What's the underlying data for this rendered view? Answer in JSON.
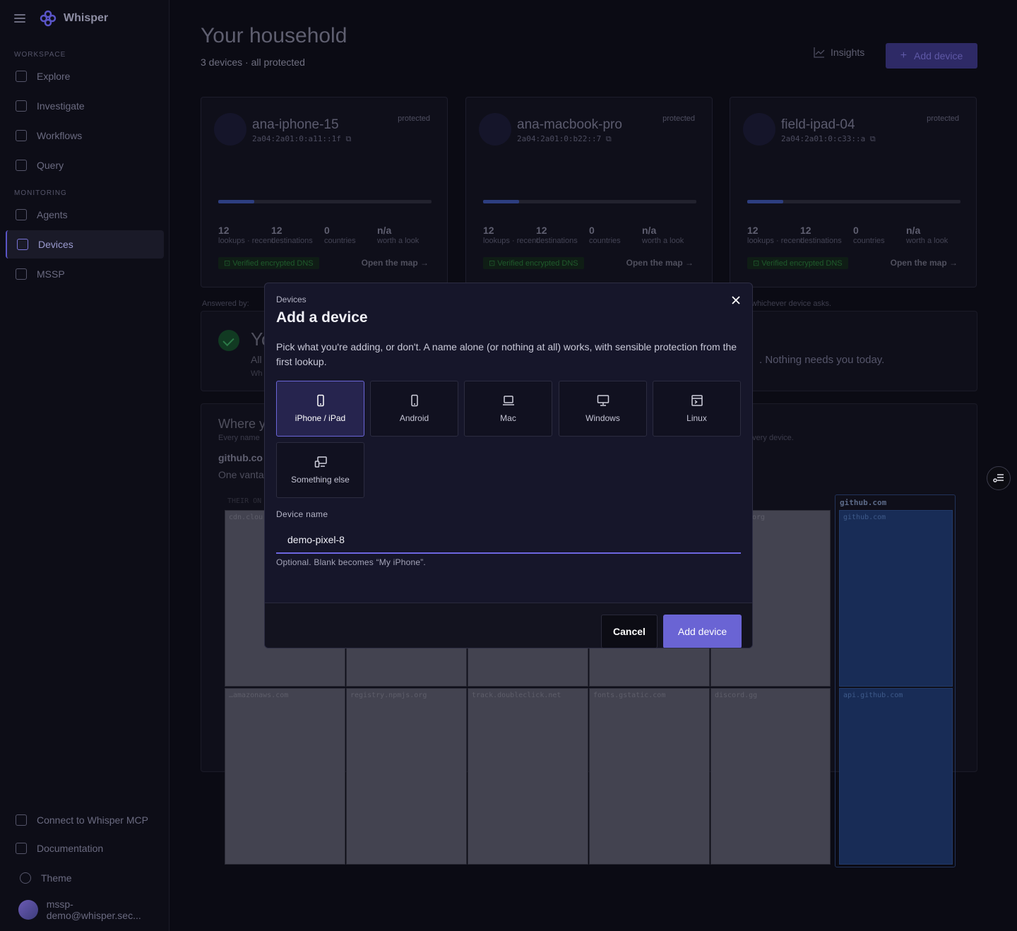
{
  "app": {
    "name": "Whisper"
  },
  "sidebar": {
    "sections": {
      "workspace": "WORKSPACE",
      "monitoring": "MONITORING"
    },
    "workspace_items": [
      {
        "label": "Explore",
        "icon": "explore-icon"
      },
      {
        "label": "Investigate",
        "icon": "investigate-icon"
      },
      {
        "label": "Workflows",
        "icon": "workflows-icon"
      },
      {
        "label": "Query",
        "icon": "query-icon"
      }
    ],
    "monitoring_items": [
      {
        "label": "Agents",
        "icon": "agents-icon"
      },
      {
        "label": "Devices",
        "icon": "devices-icon",
        "active": true
      },
      {
        "label": "MSSP",
        "icon": "mssp-icon"
      }
    ],
    "footer": {
      "mcp": "Connect to Whisper MCP",
      "docs": "Documentation",
      "theme": "Theme",
      "user": "mssp-demo@whisper.sec..."
    }
  },
  "page": {
    "title": "Your household",
    "subtitle": "3 devices · all protected",
    "insights": "Insights",
    "add_device": "Add device"
  },
  "devices": [
    {
      "name": "ana-iphone-15",
      "ip": "2a04:2a01:0:a11::1f",
      "status": "protected",
      "lookups": "12",
      "lookups_label": "lookups · recent",
      "destinations": "12",
      "destinations_label": "destinations",
      "countries": "0",
      "countries_label": "countries",
      "worth": "n/a",
      "worth_label": "worth a look",
      "dns": "Verified encrypted DNS",
      "open_map": "Open the map",
      "usage_fraction": 0.17
    },
    {
      "name": "ana-macbook-pro",
      "ip": "2a04:2a01:0:b22::7",
      "status": "protected",
      "lookups": "12",
      "lookups_label": "lookups · recent",
      "destinations": "12",
      "destinations_label": "destinations",
      "countries": "0",
      "countries_label": "countries",
      "worth": "n/a",
      "worth_label": "worth a look",
      "dns": "Verified encrypted DNS",
      "open_map": "Open the map",
      "usage_fraction": 0.17
    },
    {
      "name": "field-ipad-04",
      "ip": "2a04:2a01:0:c33::a",
      "status": "protected",
      "lookups": "12",
      "lookups_label": "lookups · recent",
      "destinations": "12",
      "destinations_label": "destinations",
      "countries": "0",
      "countries_label": "countries",
      "worth": "n/a",
      "worth_label": "worth a look",
      "dns": "Verified encrypted DNS",
      "open_map": "Open the map",
      "usage_fraction": 0.17
    }
  ],
  "background": {
    "answered_by": "Answered by:",
    "whichever": "whichever device asks.",
    "status_title": "Yo",
    "status_line1": "All",
    "status_line2": "Wh",
    "nothing": ". Nothing needs you today.",
    "where_title": "Where y",
    "where_sub": "Every name",
    "where_sub_right": "every device.",
    "where_domain": "github.co",
    "where_vantage": "One vanta",
    "their_label": "THEIR ON",
    "tiles_top": [
      "cdn.clou",
      "",
      "",
      "",
      "org"
    ],
    "tiles_bottom": [
      "…amazonaws.com",
      "registry.npmjs.org",
      "track.doubleclick.net",
      "fonts.gstatic.com",
      "discord.gg"
    ],
    "github_group": "github.com",
    "github_tiles": [
      "github.com",
      "api.github.com"
    ]
  },
  "modal": {
    "breadcrumb": "Devices",
    "title": "Add a device",
    "description": "Pick what you're adding, or don't. A name alone (or nothing at all) works, with sensible protection from the first lookup.",
    "options": [
      {
        "label": "iPhone / iPad",
        "icon": "phone-icon",
        "selected": true
      },
      {
        "label": "Android",
        "icon": "phone-icon"
      },
      {
        "label": "Mac",
        "icon": "laptop-icon"
      },
      {
        "label": "Windows",
        "icon": "monitor-icon"
      },
      {
        "label": "Linux",
        "icon": "terminal-icon"
      },
      {
        "label": "Something else",
        "icon": "devices-icon"
      }
    ],
    "field_label": "Device name",
    "field_value": "demo-pixel-8",
    "field_help": "Optional. Blank becomes “My iPhone”.",
    "cancel": "Cancel",
    "submit": "Add device"
  }
}
